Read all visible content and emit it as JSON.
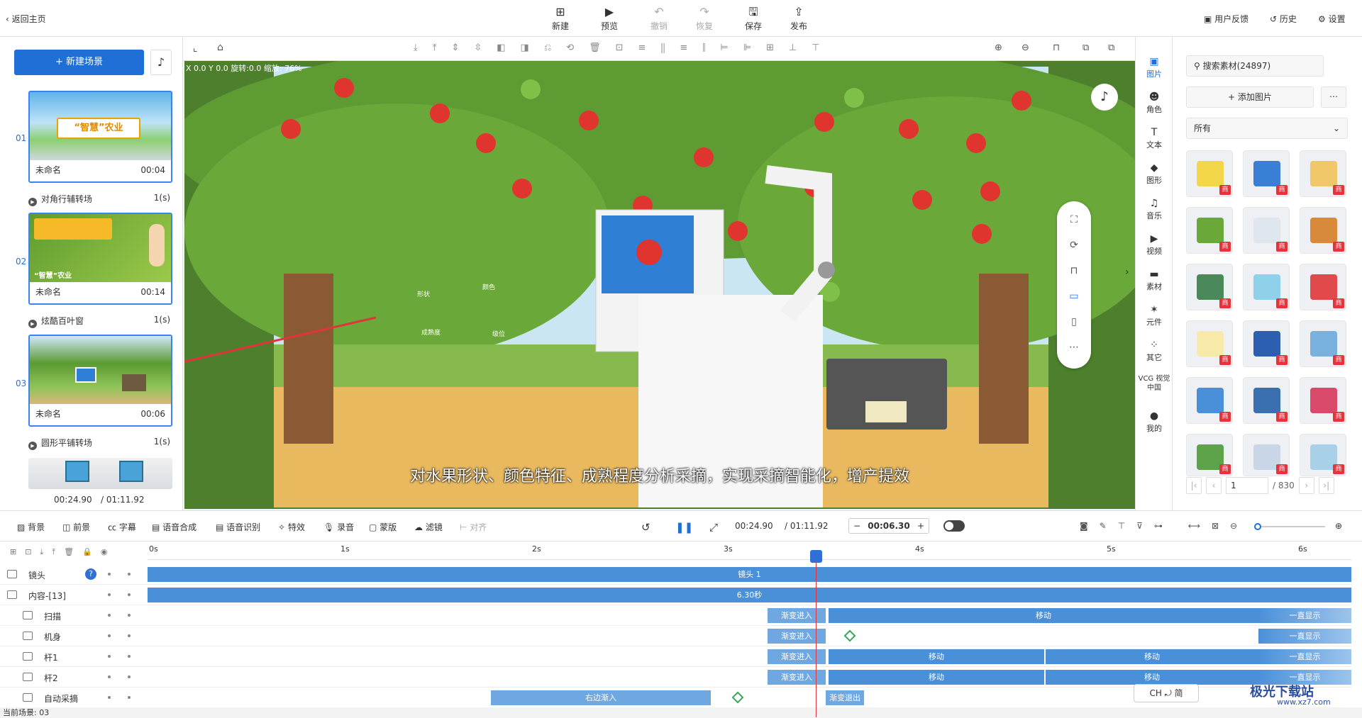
{
  "topbar": {
    "back": "返回主页",
    "tools": [
      {
        "label": "新建",
        "icon": "plus-square-icon",
        "disabled": false
      },
      {
        "label": "预览",
        "icon": "play-icon",
        "disabled": false
      },
      {
        "label": "撤销",
        "icon": "undo-icon",
        "disabled": true
      },
      {
        "label": "恢复",
        "icon": "redo-icon",
        "disabled": true
      },
      {
        "label": "保存",
        "icon": "save-icon",
        "disabled": false
      },
      {
        "label": "发布",
        "icon": "publish-icon",
        "disabled": false
      }
    ],
    "feedback": "用户反馈",
    "history": "历史",
    "settings": "设置"
  },
  "left": {
    "new_scene": "新建场景",
    "scenes": [
      {
        "index": "01",
        "name": "未命名",
        "duration": "00:04",
        "transition": "对角行辅转场",
        "tdur": "1(s)"
      },
      {
        "index": "02",
        "name": "未命名",
        "duration": "00:14",
        "transition": "炫酷百叶窗",
        "tdur": "1(s)"
      },
      {
        "index": "03",
        "name": "未命名",
        "duration": "00:06",
        "transition": "圆形平铺转场",
        "tdur": "1(s)"
      }
    ],
    "thumb1_text": "“智慧”农业",
    "thumb2_text": "“智慧”农业",
    "time_current": "00:24.90",
    "time_total": "/ 01:11.92"
  },
  "canvas": {
    "coord": "X 0.0 Y 0.0 旋转:0.0 缩放: 76%",
    "subtitle": "对水果形状、颜色特征、成熟程度分析采摘，实现采摘智能化，增产提效",
    "screen_labels": {
      "shape": "形状",
      "color": "颜色",
      "ripeness": "成熟度",
      "rank": "级位"
    }
  },
  "iconbar": [
    {
      "label": "图片",
      "icon": "image-icon",
      "active": true
    },
    {
      "label": "角色",
      "icon": "character-icon"
    },
    {
      "label": "文本",
      "icon": "text-icon"
    },
    {
      "label": "图形",
      "icon": "shape-icon"
    },
    {
      "label": "音乐",
      "icon": "music-icon"
    },
    {
      "label": "视频",
      "icon": "video-icon"
    },
    {
      "label": "素材",
      "icon": "folder-icon"
    },
    {
      "label": "元件",
      "icon": "component-icon"
    },
    {
      "label": "其它",
      "icon": "grid-icon"
    },
    {
      "label": "VCG 视觉中国",
      "icon": "vcg-icon"
    },
    {
      "label": "我的",
      "icon": "user-icon"
    }
  ],
  "materials": {
    "search_placeholder": "搜索素材(24897)",
    "add_image": "添加图片",
    "filter": "所有",
    "tag": "商",
    "page": "1",
    "page_total": "/ 830"
  },
  "timeline_toolbar": {
    "items": [
      "背景",
      "前景",
      "字幕",
      "语音合成",
      "语音识别",
      "特效",
      "录音",
      "蒙版",
      "滤镜",
      "对齐"
    ],
    "time_current": "00:24.90",
    "time_total": "/ 01:11.92",
    "duration_value": "00:06.30"
  },
  "timeline": {
    "ticks": [
      "0s",
      "1s",
      "2s",
      "3s",
      "4s",
      "5s",
      "6s"
    ],
    "camera_label": "镜头",
    "camera_bar": "镜头 1",
    "content_label": "内容-[13]",
    "content_bar": "6.30秒",
    "tracks": [
      {
        "name": "扫描",
        "bars": [
          "渐变进入",
          "移动",
          "一直显示"
        ]
      },
      {
        "name": "机身",
        "bars": [
          "渐变进入",
          "一直显示"
        ]
      },
      {
        "name": "杆1",
        "bars": [
          "渐变进入",
          "移动",
          "移动",
          "一直显示"
        ]
      },
      {
        "name": "杆2",
        "bars": [
          "渐变进入",
          "移动",
          "移动",
          "一直显示"
        ]
      },
      {
        "name": "自动采摘",
        "bars": [
          "右边渐入",
          "渐变退出"
        ]
      }
    ]
  },
  "status": {
    "current_scene": "当前场景: 03"
  },
  "ime": "CH ⤾ 简",
  "watermark": {
    "title": "极光下载站",
    "url": "www.xz7.com"
  },
  "colors": {
    "accent": "#1f6fd6",
    "track_bar": "#4a90d9",
    "playhead": "#e0353b",
    "badge": "#e0353b"
  }
}
